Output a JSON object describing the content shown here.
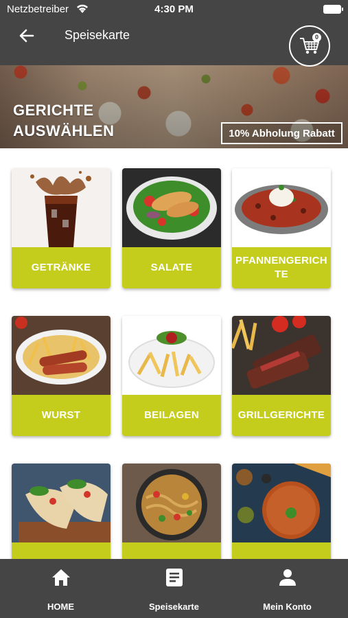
{
  "status_bar": {
    "carrier": "Netzbetreiber",
    "time": "4:30 PM"
  },
  "nav": {
    "title": "Speisekarte",
    "cart_count": "0"
  },
  "hero": {
    "title": "GERICHTE AUSWÄHLEN",
    "badge": "10% Abholung Rabatt"
  },
  "categories": [
    {
      "label": "GETRÄNKE",
      "icon": "cola-glass-image"
    },
    {
      "label": "SALATE",
      "icon": "salad-plate-image"
    },
    {
      "label": "PFANNENGERICHTE",
      "icon": "pan-dish-rice-image"
    },
    {
      "label": "WURST",
      "icon": "sausage-fries-image"
    },
    {
      "label": "BEILAGEN",
      "icon": "fries-plate-image"
    },
    {
      "label": "GRILLGERICHTE",
      "icon": "grilled-steak-image"
    },
    {
      "label": "",
      "icon": "wraps-image"
    },
    {
      "label": "",
      "icon": "noodles-wok-image"
    },
    {
      "label": "",
      "icon": "lahmacun-image"
    }
  ],
  "tabs": [
    {
      "label": "HOME",
      "icon": "home-icon"
    },
    {
      "label": "Speisekarte",
      "icon": "menu-document-icon"
    },
    {
      "label": "Mein Konto",
      "icon": "user-icon"
    }
  ],
  "colors": {
    "bar": "#454545",
    "accent": "#c5cd1c"
  }
}
